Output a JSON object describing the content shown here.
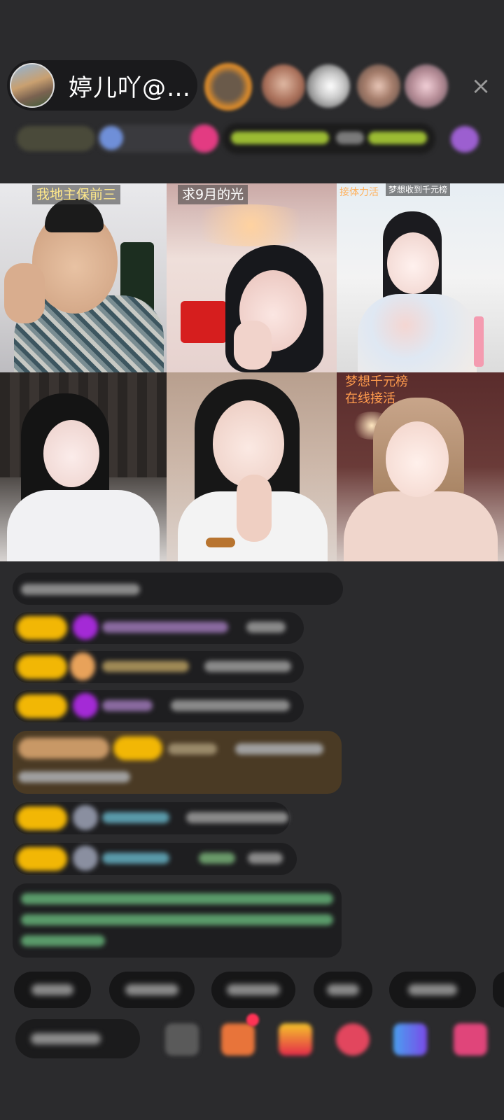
{
  "header": {
    "host_name": "婷儿吖@…",
    "close_icon": "×"
  },
  "grid": {
    "cells": [
      {
        "label": "我地主保前三"
      },
      {
        "label": "求9月的光"
      },
      {
        "label": "接体力活",
        "label2": "梦想收到千元榜"
      },
      {
        "label": ""
      },
      {
        "label": ""
      },
      {
        "label": "梦想千元榜",
        "label2": "在线接活"
      }
    ]
  },
  "colors": {
    "background": "#2b2b2d",
    "label_yellow": "#ffe98a",
    "label_orange": "#ff9b4d",
    "badge_gold": "#f2b705"
  },
  "icons": [
    "user-avatar-icon",
    "close-icon",
    "gift-box-icon",
    "gift-icon",
    "red-packet-icon",
    "game-icon",
    "shop-icon"
  ]
}
